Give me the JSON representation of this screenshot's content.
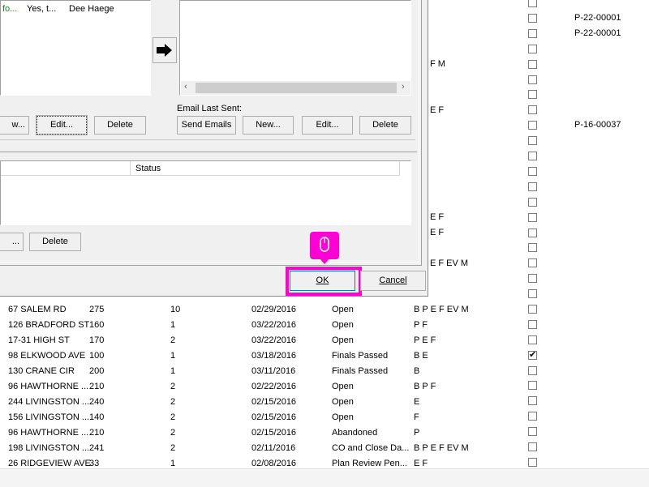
{
  "top_row": {
    "col1": "fo...",
    "col2": "Yes, t...",
    "col3": "Dee Haege"
  },
  "email_last_sent_label": "Email Last Sent:",
  "buttons": {
    "left_new_partial": "w...",
    "left_edit": "Edit...",
    "left_delete": "Delete",
    "send_emails": "Send Emails",
    "new": "New...",
    "edit": "Edit...",
    "delete": "Delete",
    "bottom_partial": "...",
    "bottom_delete": "Delete",
    "ok": "OK",
    "cancel": "Cancel"
  },
  "inner_table": {
    "status_header": "Status"
  },
  "right_column": {
    "permits": [
      "P-22-00001",
      "P-22-00001",
      "P-16-00037"
    ],
    "partial_labels": [
      "F M",
      "E F",
      "E F",
      "E F",
      "E F EV M"
    ]
  },
  "table_rows": [
    {
      "address": "67 SALEM RD",
      "num": "275",
      "count": "10",
      "date": "02/29/2016",
      "status": "Open",
      "types": "B P E F EV M",
      "checked": false
    },
    {
      "address": "126 BRADFORD ST",
      "num": "160",
      "count": "1",
      "date": "03/22/2016",
      "status": "Open",
      "types": "P F",
      "checked": false
    },
    {
      "address": "17-31 HIGH ST",
      "num": "170",
      "count": "2",
      "date": "03/22/2016",
      "status": "Open",
      "types": "P E F",
      "checked": false
    },
    {
      "address": "98 ELKWOOD AVE",
      "num": "100",
      "count": "1",
      "date": "03/18/2016",
      "status": "Finals Passed",
      "types": "B E",
      "checked": true
    },
    {
      "address": "130 CRANE CIR",
      "num": "200",
      "count": "1",
      "date": "03/11/2016",
      "status": "Finals Passed",
      "types": "B",
      "checked": false
    },
    {
      "address": "96 HAWTHORNE ...",
      "num": "210",
      "count": "2",
      "date": "02/22/2016",
      "status": "Open",
      "types": "B P F",
      "checked": false
    },
    {
      "address": "244 LIVINGSTON ...",
      "num": "240",
      "count": "2",
      "date": "02/15/2016",
      "status": "Open",
      "types": "E",
      "checked": false
    },
    {
      "address": "156 LIVINGSTON ...",
      "num": "140",
      "count": "2",
      "date": "02/15/2016",
      "status": "Open",
      "types": "F",
      "checked": false
    },
    {
      "address": "96 HAWTHORNE ...",
      "num": "210",
      "count": "2",
      "date": "02/15/2016",
      "status": "Abandoned",
      "types": "P",
      "checked": false
    },
    {
      "address": "198 LIVINGSTON ...",
      "num": "241",
      "count": "2",
      "date": "02/11/2016",
      "status": "CO and Close Da...",
      "types": "B P E F EV M",
      "checked": false
    },
    {
      "address": "26 RIDGEVIEW AVE",
      "num": "33",
      "count": "1",
      "date": "02/08/2016",
      "status": "Plan Review Pen...",
      "types": "E F",
      "checked": false
    }
  ]
}
